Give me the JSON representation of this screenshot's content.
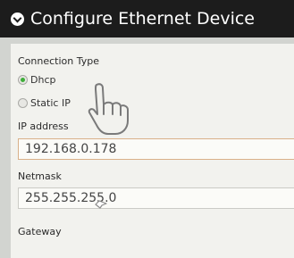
{
  "header": {
    "title": "Configure Ethernet Device",
    "icon": "chevron-down-circle-icon"
  },
  "connection_type": {
    "label": "Connection Type",
    "options": [
      {
        "label": "Dhcp",
        "selected": true
      },
      {
        "label": "Static IP",
        "selected": false
      }
    ]
  },
  "ip_address": {
    "label": "IP address",
    "value": "192.168.0.178"
  },
  "netmask": {
    "label": "Netmask",
    "value": "255.255.255.0"
  },
  "gateway": {
    "label": "Gateway"
  },
  "cursors": {
    "hand": "hand-pointer-icon",
    "pointer": "small-cursor-icon"
  },
  "colors": {
    "header_bg": "#1c1c1c",
    "radio_selected": "#3fae3a",
    "field_highlight_border": "#d9b089"
  }
}
